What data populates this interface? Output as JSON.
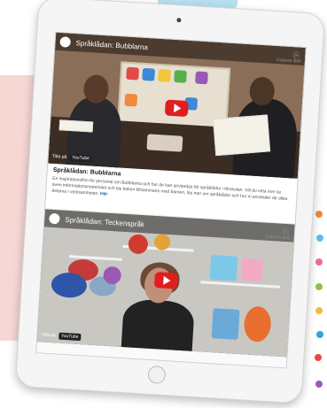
{
  "colors": {
    "play_red": "#e01e1e",
    "link_blue": "#1a5ea8",
    "decor_pink": "#f6d7d4",
    "decor_blue": "#b6dff0",
    "decor_dots": [
      "#f08a3a",
      "#5bc0eb",
      "#e86f8f",
      "#8cc63f",
      "#f6b93b",
      "#2fa4dd",
      "#e8493c",
      "#9b59b6"
    ]
  },
  "video1": {
    "title": "Språklådan: Bubblarna",
    "share_label": "Kopiera länk",
    "watch_label": "Titta på",
    "platform": "YouTube"
  },
  "caption": {
    "heading": "Språklådan: Bubblarna",
    "body": "En inspirationsfilm för personal om Bubblarna och hur de kan användas för språklådor i förskolan. Vill du veta mer se även informationsmaterialet och läs boken tillsammans med barnen, läs mer om språklådor och hur ni använder de olika delarna i verksamheten.",
    "link": "Här"
  },
  "video2": {
    "title": "Språklådan: Teckenspråk",
    "share_label": "Kopiera länk",
    "watch_label": "Titta på",
    "platform": "YouTube"
  },
  "icons": {
    "share": "share-icon",
    "play": "play-icon",
    "channel": "channel-logo-icon"
  }
}
